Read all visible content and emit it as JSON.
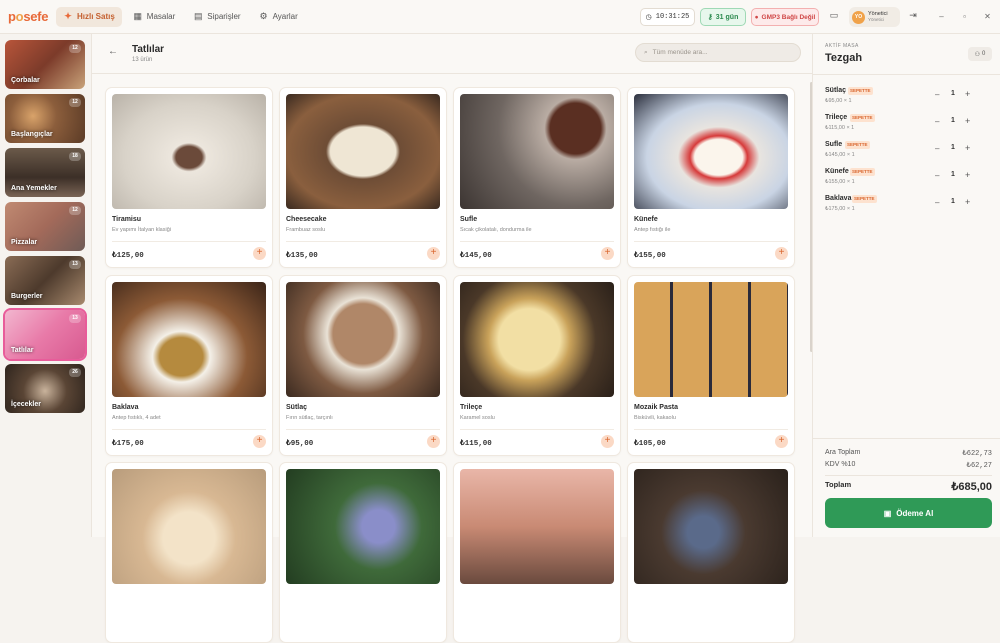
{
  "app": {
    "logo_a": "p",
    "logo_o": "o",
    "logo_b": "sefe"
  },
  "nav": [
    {
      "label": "Hızlı Satış",
      "icon": "lightning-icon",
      "active": true
    },
    {
      "label": "Masalar",
      "icon": "grid-icon",
      "active": false
    },
    {
      "label": "Siparişler",
      "icon": "receipt-icon",
      "active": false
    },
    {
      "label": "Ayarlar",
      "icon": "gear-icon",
      "active": false
    }
  ],
  "status": {
    "clock": "10:31:25",
    "days": "31 gün",
    "gmp": "GMP3 Bağlı Değil",
    "user_initials": "YO",
    "user_name": "Yönetici",
    "user_role": "Yönetici"
  },
  "categories": [
    {
      "label": "Çorbalar",
      "count": "12"
    },
    {
      "label": "Başlangıçlar",
      "count": "12"
    },
    {
      "label": "Ana Yemekler",
      "count": "18"
    },
    {
      "label": "Pizzalar",
      "count": "12"
    },
    {
      "label": "Burgerler",
      "count": "13"
    },
    {
      "label": "Tatlılar",
      "count": "13"
    },
    {
      "label": "İçecekler",
      "count": "26"
    }
  ],
  "main": {
    "title": "Tatlılar",
    "subtitle": "13 ürün",
    "search_placeholder": "Tüm menüde ara..."
  },
  "products": [
    {
      "name": "Tiramisu",
      "desc": "Ev yapımı İtalyan klasiği",
      "price": "₺125,00"
    },
    {
      "name": "Cheesecake",
      "desc": "Frambuaz soslu",
      "price": "₺135,00"
    },
    {
      "name": "Sufle",
      "desc": "Sıcak çikolatalı, dondurma ile",
      "price": "₺145,00"
    },
    {
      "name": "Künefe",
      "desc": "Antep fıstığı ile",
      "price": "₺155,00"
    },
    {
      "name": "Baklava",
      "desc": "Antep fıstıklı, 4 adet",
      "price": "₺175,00"
    },
    {
      "name": "Sütlaç",
      "desc": "Fırın sütlaç, tarçınlı",
      "price": "₺95,00"
    },
    {
      "name": "Trileçe",
      "desc": "Karamel soslu",
      "price": "₺115,00"
    },
    {
      "name": "Mozaik Pasta",
      "desc": "Bisküvili, kakaolu",
      "price": "₺105,00"
    },
    {
      "name": "",
      "desc": "",
      "price": ""
    },
    {
      "name": "",
      "desc": "",
      "price": ""
    },
    {
      "name": "",
      "desc": "",
      "price": ""
    },
    {
      "name": "",
      "desc": "",
      "price": ""
    }
  ],
  "cart": {
    "label": "AKTİF MASA",
    "table": "Tezgah",
    "people": "0",
    "items": [
      {
        "name": "Sütlaç",
        "tag": "SEPETTE",
        "line": "₺95,00 × 1",
        "qty": "1"
      },
      {
        "name": "Trileçe",
        "tag": "SEPETTE",
        "line": "₺115,00 × 1",
        "qty": "1"
      },
      {
        "name": "Sufle",
        "tag": "SEPETTE",
        "line": "₺145,00 × 1",
        "qty": "1"
      },
      {
        "name": "Künefe",
        "tag": "SEPETTE",
        "line": "₺155,00 × 1",
        "qty": "1"
      },
      {
        "name": "Baklava",
        "tag": "SEPETTE",
        "line": "₺175,00 × 1",
        "qty": "1"
      }
    ],
    "subtotal_label": "Ara Toplam",
    "subtotal": "₺622,73",
    "tax_label": "KDV %10",
    "tax": "₺62,27",
    "total_label": "Toplam",
    "total": "₺685,00",
    "pay_label": "Ödeme Al"
  },
  "colors": {
    "accent": "#e86a3a",
    "pay": "#2f9a57",
    "active_category": "#e85c9a"
  }
}
